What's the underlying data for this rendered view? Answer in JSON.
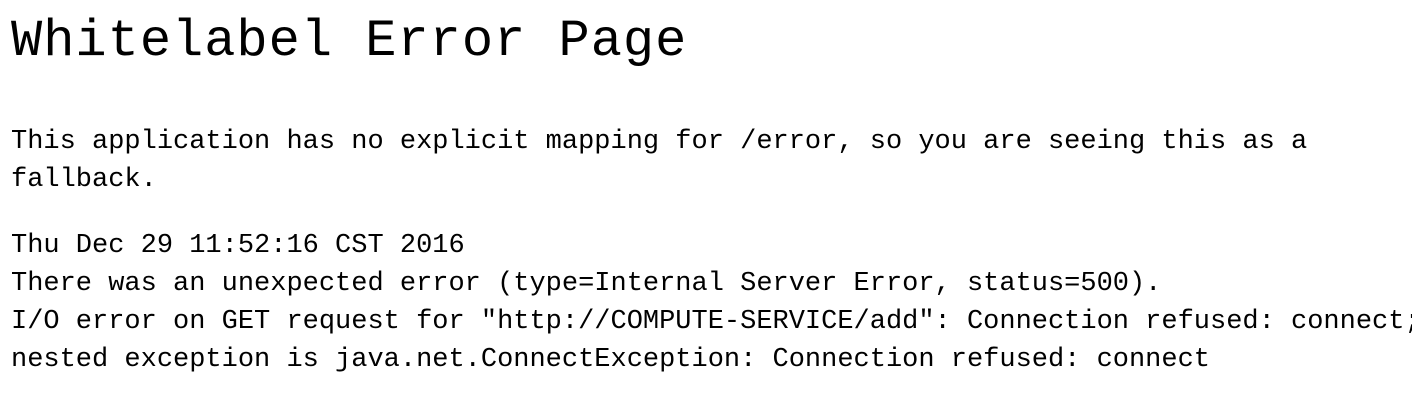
{
  "page": {
    "title": "Whitelabel Error Page",
    "message": "This application has no explicit mapping for /error, so you are seeing this as a fallback.",
    "timestamp": "Thu Dec 29 11:52:16 CST 2016",
    "error_summary": "There was an unexpected error (type=Internal Server Error, status=500).",
    "error_detail_line1": "I/O error on GET request for \"http://COMPUTE-SERVICE/add\": Connection refused: connect;",
    "error_detail_line2": "nested exception is java.net.ConnectException: Connection refused: connect"
  }
}
